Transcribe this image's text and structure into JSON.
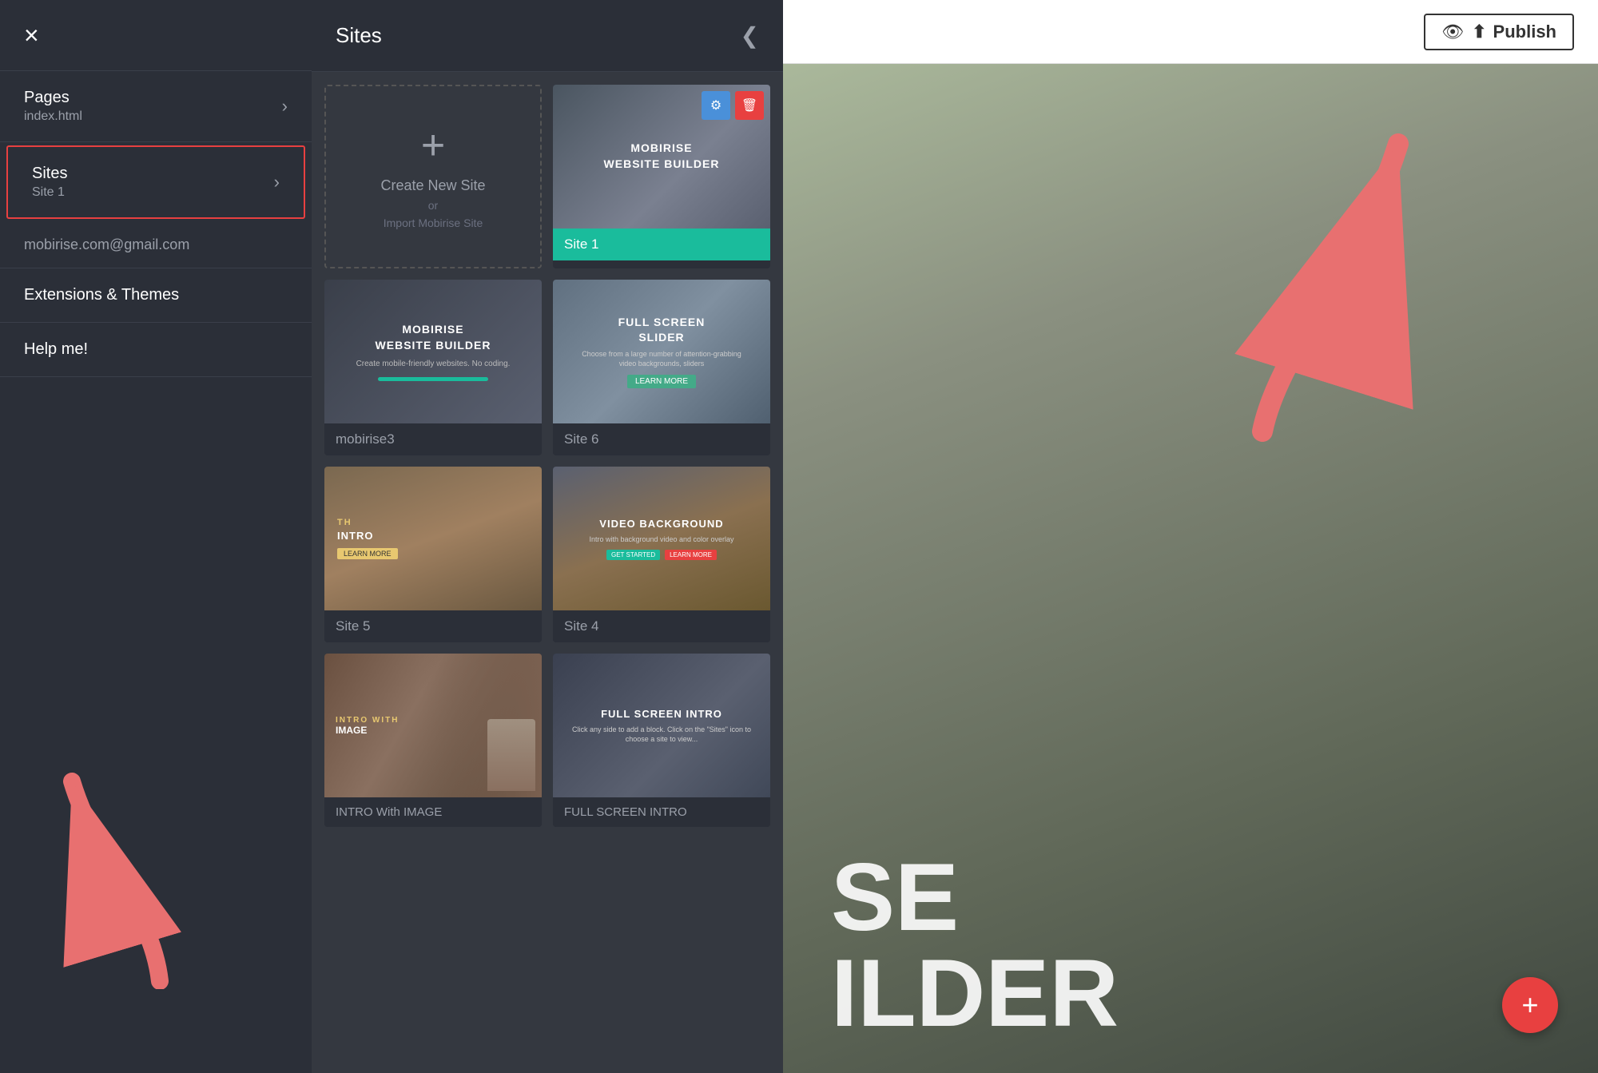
{
  "sidebar": {
    "close_label": "×",
    "nav_items": [
      {
        "label": "Pages",
        "sub": "index.html",
        "has_chevron": true,
        "highlighted": false
      },
      {
        "label": "Sites",
        "sub": "Site 1",
        "has_chevron": true,
        "highlighted": true
      }
    ],
    "email": "mobirise.com@gmail.com",
    "extensions_label": "Extensions & Themes",
    "help_label": "Help me!"
  },
  "sites_panel": {
    "title": "Sites",
    "close_icon": "❮",
    "create_plus": "+",
    "create_label": "Create New Site",
    "create_or": "or",
    "create_import": "Import Mobirise Site",
    "sites": [
      {
        "id": "site1",
        "name": "Site 1",
        "thumb_type": "mobirise",
        "thumb_title": "MOBIRISE\nWEBSITE BUILDER",
        "footer_color": "teal",
        "has_actions": true
      },
      {
        "id": "mobirise3",
        "name": "mobirise3",
        "thumb_type": "mobirise",
        "thumb_title": "MOBIRISE\nWEBSITE BUILDER",
        "footer_color": "dark",
        "has_actions": false
      },
      {
        "id": "site6",
        "name": "Site 6",
        "thumb_type": "fullscreen",
        "thumb_title": "FULL SCREEN\nSLIDER",
        "footer_color": "dark",
        "has_actions": false
      },
      {
        "id": "site5",
        "name": "Site 5",
        "thumb_type": "intro",
        "thumb_title": "TH INTRO",
        "footer_color": "dark",
        "has_actions": false
      },
      {
        "id": "site4",
        "name": "Site 4",
        "thumb_type": "video",
        "thumb_title": "VIDEO BACKGROUND",
        "footer_color": "dark",
        "has_actions": false
      },
      {
        "id": "intro-image",
        "name": "INTRO With IMAGE",
        "thumb_type": "intro_image",
        "thumb_title": "INTRO WITH IMAGE",
        "footer_color": "dark",
        "has_actions": false
      },
      {
        "id": "full-screen-intro",
        "name": "FULL SCREEN INTRO",
        "thumb_type": "fullscreen_intro",
        "thumb_title": "FULL SCREEN INTRO",
        "footer_color": "dark",
        "has_actions": false
      }
    ]
  },
  "header": {
    "publish_label": "Publish",
    "preview_icon": "👁"
  },
  "main": {
    "hero_line1": "SE",
    "hero_line2": "ILDER"
  },
  "fab": {
    "label": "+"
  },
  "colors": {
    "accent_red": "#e84040",
    "teal": "#1abc9c",
    "dark_bg": "#2b2f38"
  }
}
